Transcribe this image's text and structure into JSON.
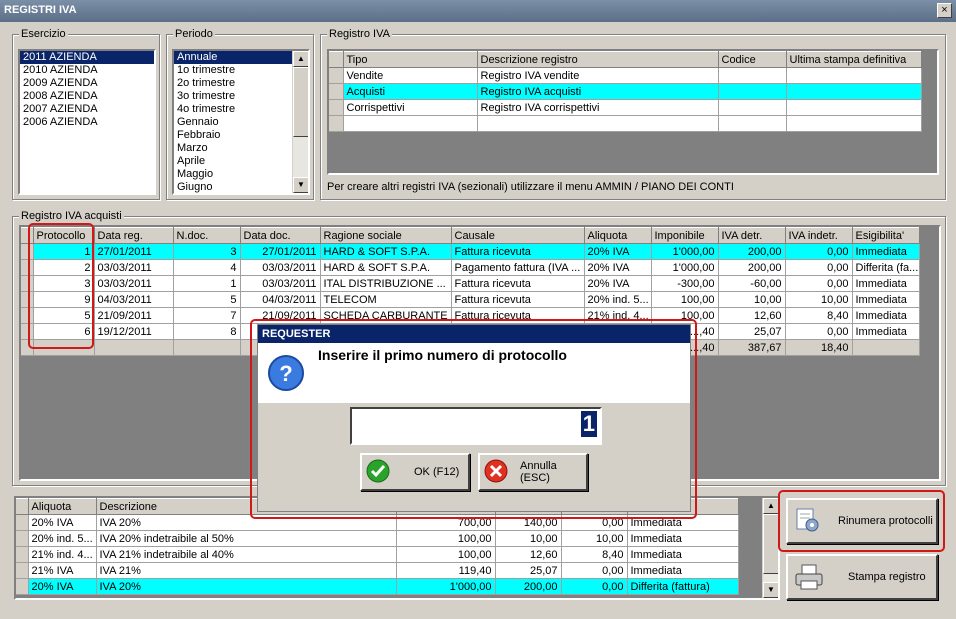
{
  "window": {
    "title": "REGISTRI IVA",
    "close": "×"
  },
  "esercizio": {
    "label": "Esercizio",
    "items": [
      "2011 AZIENDA",
      "2010 AZIENDA",
      "2009 AZIENDA",
      "2008 AZIENDA",
      "2007 AZIENDA",
      "2006 AZIENDA"
    ],
    "selected": 0
  },
  "periodo": {
    "label": "Periodo",
    "items": [
      "Annuale",
      "1o trimestre",
      "2o trimestre",
      "3o trimestre",
      "4o trimestre",
      "Gennaio",
      "Febbraio",
      "Marzo",
      "Aprile",
      "Maggio",
      "Giugno"
    ],
    "selected": 0
  },
  "registro": {
    "label": "Registro IVA",
    "columns": [
      "Tipo",
      "Descrizione registro",
      "Codice",
      "Ultima stampa definitiva"
    ],
    "rows": [
      [
        "Vendite",
        "Registro IVA vendite",
        "",
        ""
      ],
      [
        "Acquisti",
        "Registro IVA acquisti",
        "",
        ""
      ],
      [
        "Corrispettivi",
        "Registro IVA corrispettivi",
        "",
        ""
      ],
      [
        "",
        "",
        "",
        ""
      ]
    ],
    "highlight": 1,
    "note": "Per creare altri registri IVA (sezionali) utilizzare il menu AMMIN / PIANO DEI CONTI"
  },
  "acquisti": {
    "label": "Registro IVA acquisti",
    "columns": [
      "Protocollo",
      "Data reg.",
      "N.doc.",
      "Data doc.",
      "Ragione sociale",
      "Causale",
      "Aliquota",
      "Imponibile",
      "IVA detr.",
      "IVA indetr.",
      "Esigibilita'"
    ],
    "rows": [
      [
        "1",
        "27/01/2011",
        "3",
        "27/01/2011",
        "HARD & SOFT S.P.A.",
        "Fattura ricevuta",
        "20% IVA",
        "1'000,00",
        "200,00",
        "0,00",
        "Immediata"
      ],
      [
        "2",
        "03/03/2011",
        "4",
        "03/03/2011",
        "HARD & SOFT S.P.A.",
        "Pagamento fattura (IVA ...",
        "20% IVA",
        "1'000,00",
        "200,00",
        "0,00",
        "Differita (fa..."
      ],
      [
        "3",
        "03/03/2011",
        "1",
        "03/03/2011",
        "ITAL DISTRIBUZIONE ...",
        "Fattura ricevuta",
        "20% IVA",
        "-300,00",
        "-60,00",
        "0,00",
        "Immediata"
      ],
      [
        "9",
        "04/03/2011",
        "5",
        "04/03/2011",
        "TELECOM",
        "Fattura ricevuta",
        "20% ind. 5...",
        "100,00",
        "10,00",
        "10,00",
        "Immediata"
      ],
      [
        "5",
        "21/09/2011",
        "7",
        "21/09/2011",
        "SCHEDA CARBURANTE",
        "Fattura ricevuta",
        "21% ind. 4...",
        "100,00",
        "12,60",
        "8,40",
        "Immediata"
      ],
      [
        "6",
        "19/12/2011",
        "8",
        "",
        "",
        "",
        "",
        "...,40",
        "25,07",
        "0,00",
        "Immediata"
      ]
    ],
    "totals": [
      "",
      "",
      "",
      "",
      "",
      "",
      "",
      "...,40",
      "387,67",
      "18,40",
      ""
    ],
    "highlight": 0
  },
  "riepilogo": {
    "columns": [
      "Aliquota",
      "Descrizione",
      "",
      "",
      "",
      ""
    ],
    "rows": [
      [
        "20% IVA",
        "IVA 20%",
        "700,00",
        "140,00",
        "0,00",
        "Immediata"
      ],
      [
        "20% ind. 5...",
        "IVA 20% indetraibile al 50%",
        "100,00",
        "10,00",
        "10,00",
        "Immediata"
      ],
      [
        "21% ind. 4...",
        "IVA 21% indetraibile al 40%",
        "100,00",
        "12,60",
        "8,40",
        "Immediata"
      ],
      [
        "21% IVA",
        "IVA 21%",
        "119,40",
        "25,07",
        "0,00",
        "Immediata"
      ],
      [
        "20% IVA",
        "IVA 20%",
        "1'000,00",
        "200,00",
        "0,00",
        "Differita (fattura)"
      ]
    ],
    "highlight": 4
  },
  "buttons": {
    "rinumera": "Rinumera protocolli",
    "stampa": "Stampa registro"
  },
  "dialog": {
    "title": "REQUESTER",
    "message": "Inserire il primo numero di protocollo",
    "value": "1",
    "ok": "OK (F12)",
    "cancel": "Annulla (ESC)"
  }
}
